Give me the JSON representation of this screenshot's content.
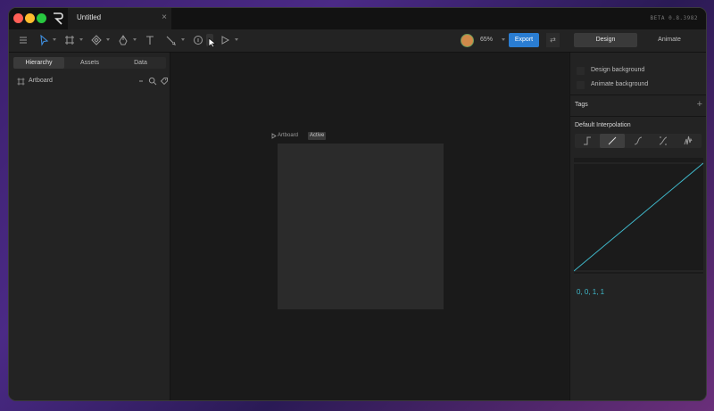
{
  "titlebar": {
    "document_title": "Untitled",
    "close_glyph": "×",
    "version": "BETA 0.8.3982",
    "app_logo_icon": "rive-logo-icon"
  },
  "toolbar": {
    "tools": [
      {
        "name": "menu-icon"
      },
      {
        "name": "select-tool-icon"
      },
      {
        "name": "artboard-tool-icon"
      },
      {
        "name": "bone-tool-icon"
      },
      {
        "name": "pen-tool-icon"
      },
      {
        "name": "text-tool-icon"
      },
      {
        "name": "brush-tool-icon"
      },
      {
        "name": "circle-tool-icon"
      },
      {
        "name": "play-tool-icon"
      }
    ],
    "zoom": "65%",
    "export_label": "Export",
    "swap_glyph": "⇄",
    "modes": {
      "design": "Design",
      "animate": "Animate"
    }
  },
  "left_panel": {
    "tabs": [
      "Hierarchy",
      "Assets",
      "Data"
    ],
    "active_tab": "Hierarchy",
    "rows": [
      {
        "label": "Artboard"
      }
    ]
  },
  "canvas": {
    "artboard_label": "Artboard",
    "artboard_badge": "Active",
    "artboard_color": "#2b2b2b"
  },
  "right_panel": {
    "options": [
      {
        "label": "Design background",
        "checked": false
      },
      {
        "label": "Animate background",
        "checked": false
      }
    ],
    "tags_title": "Tags",
    "add_glyph": "+",
    "interpolation_title": "Default Interpolation",
    "interpolation_options": [
      "hold",
      "linear",
      "cubic",
      "custom",
      "elastic"
    ],
    "interpolation_selected": "linear",
    "bezier_values": "0, 0, 1, 1",
    "curve_color": "#3fb7c9"
  }
}
